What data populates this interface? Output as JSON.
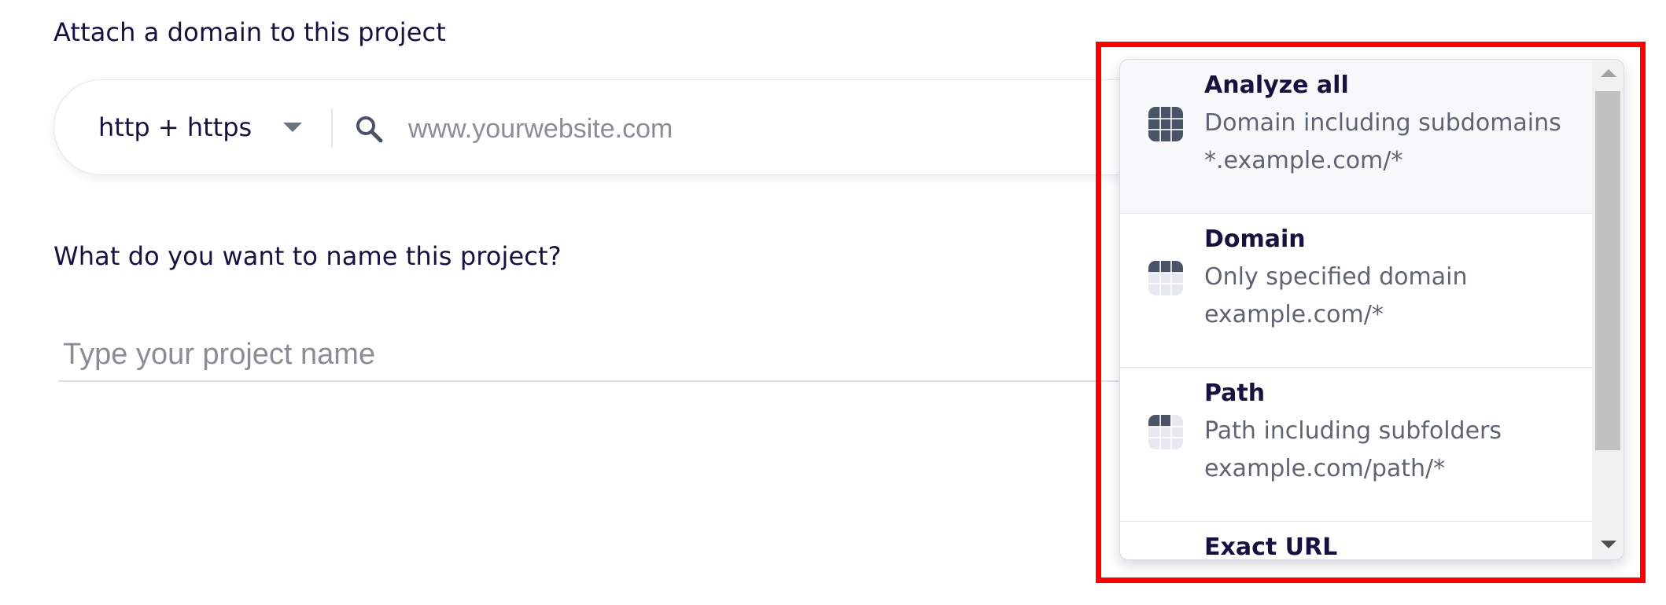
{
  "form": {
    "domain_heading": "Attach a domain to this project",
    "protocol_selected": "http + https",
    "domain_placeholder": "www.yourwebsite.com",
    "domain_value": "",
    "name_heading": "What do you want to name this project?",
    "name_placeholder": "Type your project name",
    "name_value": ""
  },
  "scope_dropdown": {
    "options": [
      {
        "title": "Analyze all",
        "description": "Domain including subdomains",
        "example": "*.example.com/*",
        "icon": "grid-all-icon",
        "selected": true
      },
      {
        "title": "Domain",
        "description": "Only specified domain",
        "example": "example.com/*",
        "icon": "grid-domain-icon",
        "selected": false
      },
      {
        "title": "Path",
        "description": "Path including subfolders",
        "example": "example.com/path/*",
        "icon": "grid-path-icon",
        "selected": false
      },
      {
        "title": "Exact URL"
      }
    ]
  },
  "colors": {
    "text_primary": "#15123f",
    "text_secondary": "#5d6472",
    "placeholder": "#8a8d93",
    "icon_dark": "#4b5366",
    "icon_light": "#e6e9f0",
    "highlight_frame": "#ff0000"
  }
}
